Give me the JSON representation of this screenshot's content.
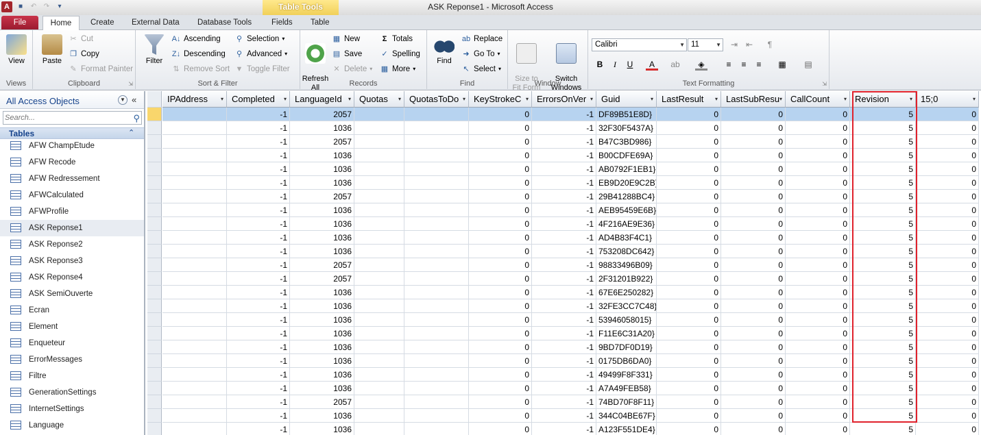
{
  "window": {
    "title": "ASK Reponse1  -  Microsoft Access",
    "app_icon": "A"
  },
  "tabs": {
    "file": "File",
    "home": "Home",
    "create": "Create",
    "external": "External Data",
    "dbtools": "Database Tools",
    "fields": "Fields",
    "table": "Table",
    "context": "Table Tools"
  },
  "ribbon": {
    "views": {
      "label": "Views",
      "view": "View"
    },
    "clipboard": {
      "label": "Clipboard",
      "paste": "Paste",
      "cut": "Cut",
      "copy": "Copy",
      "format_painter": "Format Painter"
    },
    "sort_filter": {
      "label": "Sort & Filter",
      "filter": "Filter",
      "ascending": "Ascending",
      "descending": "Descending",
      "remove_sort": "Remove Sort",
      "selection": "Selection",
      "advanced": "Advanced",
      "toggle_filter": "Toggle Filter"
    },
    "records": {
      "label": "Records",
      "refresh_all": "Refresh\nAll",
      "new": "New",
      "save": "Save",
      "delete": "Delete",
      "totals": "Totals",
      "spelling": "Spelling",
      "more": "More"
    },
    "find": {
      "label": "Find",
      "find": "Find",
      "replace": "Replace",
      "goto": "Go To",
      "select": "Select"
    },
    "window": {
      "label": "Window",
      "size_to_fit": "Size to\nFit Form",
      "switch_windows": "Switch\nWindows"
    },
    "text_formatting": {
      "label": "Text Formatting",
      "font": "Calibri",
      "size": "11"
    }
  },
  "nav": {
    "title": "All Access Objects",
    "search_placeholder": "Search...",
    "category": "Tables",
    "items": [
      "AFW ChampEtude",
      "AFW Recode",
      "AFW Redressement",
      "AFWCalculated",
      "AFWProfile",
      "ASK Reponse1",
      "ASK Reponse2",
      "ASK Reponse3",
      "ASK Reponse4",
      "ASK SemiOuverte",
      "Ecran",
      "Element",
      "Enqueteur",
      "ErrorMessages",
      "Filtre",
      "GenerationSettings",
      "InternetSettings",
      "Language"
    ],
    "selected": "ASK Reponse1"
  },
  "grid": {
    "columns": [
      "IPAddress",
      "Completed",
      "LanguageId",
      "Quotas",
      "QuotasToDo",
      "KeyStrokeC",
      "ErrorsOnVer",
      "Guid",
      "LastResult",
      "LastSubResu",
      "CallCount",
      "Revision",
      "15;0"
    ],
    "highlighted_column": "Revision",
    "rows": [
      [
        "",
        "-1",
        "2057",
        "",
        "",
        "0",
        "-1",
        "DF89B51E8D}",
        "0",
        "0",
        "0",
        "5",
        "0"
      ],
      [
        "",
        "-1",
        "1036",
        "",
        "",
        "0",
        "-1",
        "32F30F5437A}",
        "0",
        "0",
        "0",
        "5",
        "0"
      ],
      [
        "",
        "-1",
        "2057",
        "",
        "",
        "0",
        "-1",
        "B47C3BD986}",
        "0",
        "0",
        "0",
        "5",
        "0"
      ],
      [
        "",
        "-1",
        "1036",
        "",
        "",
        "0",
        "-1",
        "B00CDFE69A}",
        "0",
        "0",
        "0",
        "5",
        "0"
      ],
      [
        "",
        "-1",
        "1036",
        "",
        "",
        "0",
        "-1",
        "AB0792F1EB1}",
        "0",
        "0",
        "0",
        "5",
        "0"
      ],
      [
        "",
        "-1",
        "1036",
        "",
        "",
        "0",
        "-1",
        "EB9D20E9C2B}",
        "0",
        "0",
        "0",
        "5",
        "0"
      ],
      [
        "",
        "-1",
        "2057",
        "",
        "",
        "0",
        "-1",
        "29B41288BC4}",
        "0",
        "0",
        "0",
        "5",
        "0"
      ],
      [
        "",
        "-1",
        "1036",
        "",
        "",
        "0",
        "-1",
        "AEB95459E6B}",
        "0",
        "0",
        "0",
        "5",
        "0"
      ],
      [
        "",
        "-1",
        "1036",
        "",
        "",
        "0",
        "-1",
        "4F216AE9E36}",
        "0",
        "0",
        "0",
        "5",
        "0"
      ],
      [
        "",
        "-1",
        "1036",
        "",
        "",
        "0",
        "-1",
        "AD4B83F4C1}",
        "0",
        "0",
        "0",
        "5",
        "0"
      ],
      [
        "",
        "-1",
        "1036",
        "",
        "",
        "0",
        "-1",
        "753208DC642}",
        "0",
        "0",
        "0",
        "5",
        "0"
      ],
      [
        "",
        "-1",
        "2057",
        "",
        "",
        "0",
        "-1",
        "98833496B09}",
        "0",
        "0",
        "0",
        "5",
        "0"
      ],
      [
        "",
        "-1",
        "2057",
        "",
        "",
        "0",
        "-1",
        "2F31201B922}",
        "0",
        "0",
        "0",
        "5",
        "0"
      ],
      [
        "",
        "-1",
        "1036",
        "",
        "",
        "0",
        "-1",
        "67E6E250282}",
        "0",
        "0",
        "0",
        "5",
        "0"
      ],
      [
        "",
        "-1",
        "1036",
        "",
        "",
        "0",
        "-1",
        "32FE3CC7C48}",
        "0",
        "0",
        "0",
        "5",
        "0"
      ],
      [
        "",
        "-1",
        "1036",
        "",
        "",
        "0",
        "-1",
        "53946058015}",
        "0",
        "0",
        "0",
        "5",
        "0"
      ],
      [
        "",
        "-1",
        "1036",
        "",
        "",
        "0",
        "-1",
        "F11E6C31A20}",
        "0",
        "0",
        "0",
        "5",
        "0"
      ],
      [
        "",
        "-1",
        "1036",
        "",
        "",
        "0",
        "-1",
        "9BD7DF0D19}",
        "0",
        "0",
        "0",
        "5",
        "0"
      ],
      [
        "",
        "-1",
        "1036",
        "",
        "",
        "0",
        "-1",
        "0175DB6DA0}",
        "0",
        "0",
        "0",
        "5",
        "0"
      ],
      [
        "",
        "-1",
        "1036",
        "",
        "",
        "0",
        "-1",
        "49499F8F331}",
        "0",
        "0",
        "0",
        "5",
        "0"
      ],
      [
        "",
        "-1",
        "1036",
        "",
        "",
        "0",
        "-1",
        "A7A49FEB58}",
        "0",
        "0",
        "0",
        "5",
        "0"
      ],
      [
        "",
        "-1",
        "2057",
        "",
        "",
        "0",
        "-1",
        "74BD70F8F11}",
        "0",
        "0",
        "0",
        "5",
        "0"
      ],
      [
        "",
        "-1",
        "1036",
        "",
        "",
        "0",
        "-1",
        "344C04BE67F}",
        "0",
        "0",
        "0",
        "5",
        "0"
      ],
      [
        "",
        "-1",
        "1036",
        "",
        "",
        "0",
        "-1",
        "A123F551DE4}",
        "0",
        "0",
        "0",
        "5",
        "0"
      ]
    ]
  },
  "colors": {
    "accent": "#a4262c",
    "highlight": "#e0212b",
    "selected_row": "#b7d3f0"
  }
}
